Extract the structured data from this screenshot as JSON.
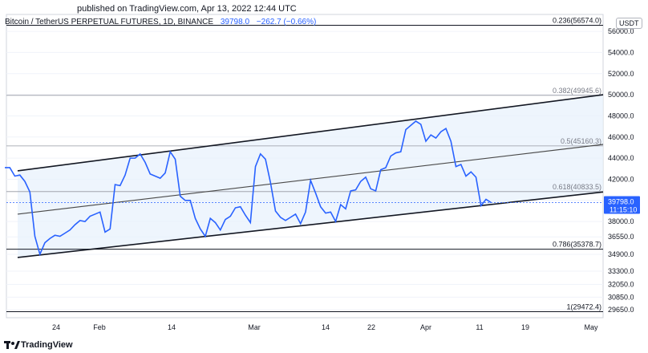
{
  "header": {
    "published": "published on TradingView.com, Apr 13, 2022 12:44 UTC"
  },
  "symbol": {
    "name": "Bitcoin / TetherUS PERPETUAL FUTURES, 1D, BINANCE",
    "last": "39798.0",
    "change": "−262.7 (−0.66%)",
    "currency": "USDT"
  },
  "footer": {
    "brand": "TradingView"
  },
  "colors": {
    "price": "#2962ff",
    "channel_fill": "#e8f2fc",
    "channel_line": "#131722",
    "fib_line": "#787b86"
  },
  "chart_data": {
    "type": "line",
    "x_labels": [
      "24",
      "Feb",
      "14",
      "Mar",
      "14",
      "22",
      "Apr",
      "11",
      "19",
      "May"
    ],
    "y_ticks": [
      29650,
      30850,
      32050,
      33300,
      34900,
      36550,
      38000,
      40000,
      42000,
      44000,
      46000,
      48000,
      50000,
      52000,
      54000,
      56000
    ],
    "y_tick_labels": [
      "29650.0",
      "30850.0",
      "32050.0",
      "33300.0",
      "34900.0",
      "36550.0",
      "38000.0",
      "40000.0",
      "42000.0",
      "44000.0",
      "46000.0",
      "48000.0",
      "50000.0",
      "52000.0",
      "54000.0",
      "56000.0"
    ],
    "ylim": [
      28900,
      57600
    ],
    "fib_levels": [
      {
        "label": "0.236(56574.0)",
        "value": 56574.0
      },
      {
        "label": "0.382(49945.6)",
        "value": 49945.6
      },
      {
        "label": "0.5(45160.3)",
        "value": 45160.3
      },
      {
        "label": "0.618(40833.5)",
        "value": 40833.5
      },
      {
        "label": "0.786(35378.7)",
        "value": 35378.7
      },
      {
        "label": "1(29472.4)",
        "value": 29472.4
      }
    ],
    "last_price": {
      "value": 39798.0,
      "label": "39798.0",
      "countdown": "11:15:10"
    },
    "series": [
      {
        "values": [
          43100,
          43100,
          42300,
          42400,
          41800,
          40800,
          36600,
          34900,
          36000,
          36400,
          36700,
          36600,
          36900,
          37200,
          37700,
          38100,
          38000,
          38500,
          38700,
          38900,
          37000,
          37300,
          41500,
          41400,
          42400,
          44000,
          44000,
          44400,
          43600,
          42500,
          42300,
          42100,
          42600,
          44600,
          43900,
          40400,
          40000,
          40000,
          38300,
          37300,
          36600,
          38300,
          37900,
          37200,
          38200,
          38500,
          39300,
          39400,
          38600,
          37900,
          43200,
          44400,
          43900,
          41700,
          39000,
          38400,
          38100,
          38400,
          38700,
          37800,
          38900,
          41900,
          40700,
          39400,
          38800,
          38900,
          38000,
          39600,
          39200,
          40900,
          41000,
          41800,
          42200,
          41100,
          40900,
          42900,
          43100,
          44200,
          44500,
          44600,
          46700,
          47100,
          47500,
          47200,
          45600,
          46200,
          45900,
          46500,
          46800,
          45600,
          43200,
          43400,
          42300,
          42700,
          42200,
          39500,
          40100,
          39800
        ]
      }
    ],
    "channel": {
      "upper": [
        [
          0,
          42800
        ],
        [
          97,
          50000
        ]
      ],
      "mid": [
        [
          0,
          38700
        ],
        [
          97,
          45300
        ]
      ],
      "lower": [
        [
          0,
          34600
        ],
        [
          97,
          40800
        ]
      ]
    }
  }
}
